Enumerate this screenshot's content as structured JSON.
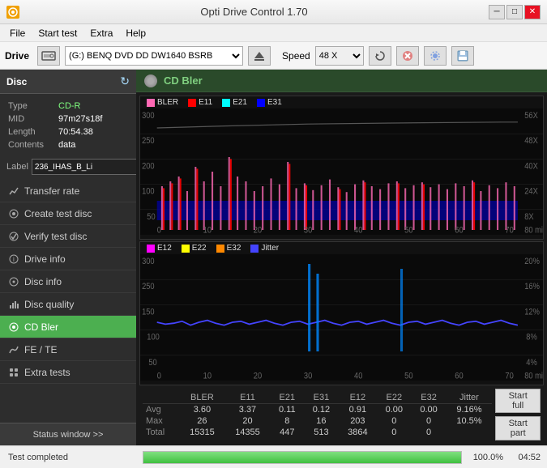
{
  "app": {
    "title": "Opti Drive Control 1.70",
    "icon": "disc-icon"
  },
  "titlebar": {
    "title": "Opti Drive Control 1.70",
    "minimize_label": "─",
    "restore_label": "□",
    "close_label": "✕"
  },
  "menubar": {
    "items": [
      "File",
      "Start test",
      "Extra",
      "Help"
    ]
  },
  "drivebar": {
    "drive_label": "Drive",
    "drive_value": "(G:)  BENQ DVD DD DW1640 BSRB",
    "speed_label": "Speed",
    "speed_value": "48 X"
  },
  "disc": {
    "header": "Disc",
    "type_label": "Type",
    "type_value": "CD-R",
    "mid_label": "MID",
    "mid_value": "97m27s18f",
    "length_label": "Length",
    "length_value": "70:54.38",
    "contents_label": "Contents",
    "contents_value": "data",
    "label_label": "Label",
    "label_value": "236_IHAS_B_Li"
  },
  "sidebar": {
    "items": [
      {
        "id": "transfer-rate",
        "label": "Transfer rate",
        "icon": "chart-icon"
      },
      {
        "id": "create-test-disc",
        "label": "Create test disc",
        "icon": "disc-write-icon"
      },
      {
        "id": "verify-test-disc",
        "label": "Verify test disc",
        "icon": "verify-icon"
      },
      {
        "id": "drive-info",
        "label": "Drive info",
        "icon": "info-icon"
      },
      {
        "id": "disc-info",
        "label": "Disc info",
        "icon": "disc-info-icon"
      },
      {
        "id": "disc-quality",
        "label": "Disc quality",
        "icon": "quality-icon"
      },
      {
        "id": "cd-bler",
        "label": "CD Bler",
        "icon": "bler-icon",
        "active": true
      },
      {
        "id": "fe-te",
        "label": "FE / TE",
        "icon": "fe-icon"
      },
      {
        "id": "extra-tests",
        "label": "Extra tests",
        "icon": "extra-icon"
      }
    ],
    "status_window_label": "Status window >>"
  },
  "cd_bler": {
    "title": "CD Bler",
    "chart1": {
      "legend": [
        {
          "label": "BLER",
          "color": "#ff69b4"
        },
        {
          "label": "E11",
          "color": "#ff0000"
        },
        {
          "label": "E21",
          "color": "#00ffff"
        },
        {
          "label": "E31",
          "color": "#0000ff"
        }
      ],
      "y_max": 300,
      "y_right_max": "56 X",
      "x_max": 80
    },
    "chart2": {
      "legend": [
        {
          "label": "E12",
          "color": "#ff00ff"
        },
        {
          "label": "E22",
          "color": "#ffff00"
        },
        {
          "label": "E32",
          "color": "#ff8800"
        },
        {
          "label": "Jitter",
          "color": "#4444ff"
        }
      ],
      "y_max": 300,
      "y_right_max": "20%",
      "x_max": 80
    },
    "stats": {
      "columns": [
        "",
        "BLER",
        "E11",
        "E21",
        "E31",
        "E12",
        "E22",
        "E32",
        "Jitter"
      ],
      "rows": [
        {
          "label": "Avg",
          "values": [
            "3.60",
            "3.37",
            "0.11",
            "0.12",
            "0.91",
            "0.00",
            "0.00",
            "9.16%"
          ]
        },
        {
          "label": "Max",
          "values": [
            "26",
            "20",
            "8",
            "16",
            "203",
            "0",
            "0",
            "10.5%"
          ]
        },
        {
          "label": "Total",
          "values": [
            "15315",
            "14355",
            "447",
            "513",
            "3864",
            "0",
            "0",
            ""
          ]
        }
      ],
      "start_full_label": "Start full",
      "start_part_label": "Start part"
    }
  },
  "statusbar": {
    "status_text": "Test completed",
    "progress_percent": "100.0%",
    "progress_value": 100,
    "time": "04:52"
  }
}
